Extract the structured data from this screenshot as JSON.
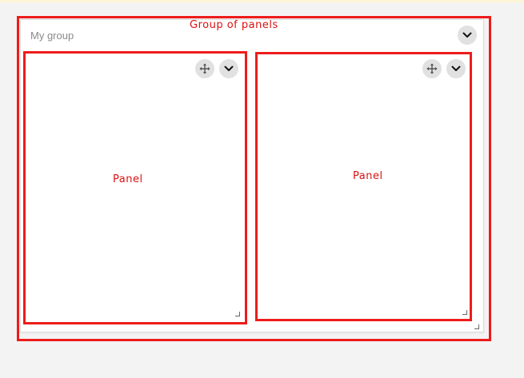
{
  "group": {
    "title": "My group",
    "annotation_label": "Group of panels"
  },
  "panels": [
    {
      "annotation_label": "Panel"
    },
    {
      "annotation_label": "Panel"
    }
  ],
  "icons": {
    "move": "move-icon",
    "collapse": "chevron-down-icon",
    "resize": "resize-grip-icon"
  },
  "colors": {
    "annotation": "#ee1b1b",
    "button_bg": "#e1e1e1",
    "page_bg": "#f3f3f3"
  }
}
